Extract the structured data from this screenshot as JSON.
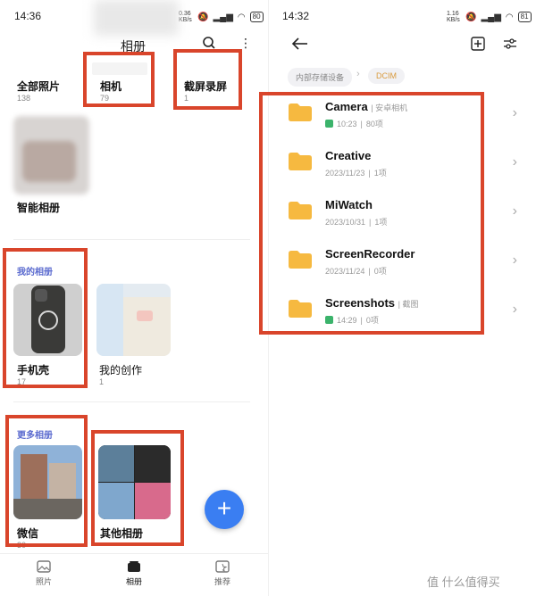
{
  "left": {
    "status_time": "14:36",
    "status_speed": "0.36 KB/s",
    "status_battery": "80",
    "title": "相册",
    "top_albums": [
      {
        "name": "全部照片",
        "count": "138"
      },
      {
        "name": "相机",
        "count": "79"
      },
      {
        "name": "截屏录屏",
        "count": "1"
      }
    ],
    "smart_album": "智能相册",
    "my_albums_label": "我的相册",
    "my_albums": [
      {
        "name": "手机壳",
        "count": "17"
      },
      {
        "name": "我的创作",
        "count": "1"
      }
    ],
    "more_albums_label": "更多相册",
    "more_albums": [
      {
        "name": "微信",
        "count": "30"
      },
      {
        "name": "其他相册",
        "count": ""
      }
    ],
    "fab_label": "+",
    "nav": [
      {
        "label": "照片"
      },
      {
        "label": "相册"
      },
      {
        "label": "推荐"
      }
    ]
  },
  "right": {
    "status_time": "14:32",
    "status_speed": "1.16 KB/s",
    "status_battery": "81",
    "breadcrumb": [
      "内部存储设备",
      "DCIM"
    ],
    "folders": [
      {
        "name": "Camera",
        "tag": "安卓相机",
        "meta": "10:23",
        "count": "80项",
        "green": true
      },
      {
        "name": "Creative",
        "tag": "",
        "meta": "2023/11/23",
        "count": "1项",
        "green": false
      },
      {
        "name": "MiWatch",
        "tag": "",
        "meta": "2023/10/31",
        "count": "1项",
        "green": false
      },
      {
        "name": "ScreenRecorder",
        "tag": "",
        "meta": "2023/11/24",
        "count": "0项",
        "green": false
      },
      {
        "name": "Screenshots",
        "tag": "截图",
        "meta": "14:29",
        "count": "0项",
        "green": true
      }
    ]
  },
  "watermark": "值 什么值得买",
  "colors": {
    "highlight": "#d9452b",
    "accent": "#3a7ef2",
    "folder": "#f6b940",
    "section": "#5a6acf"
  }
}
